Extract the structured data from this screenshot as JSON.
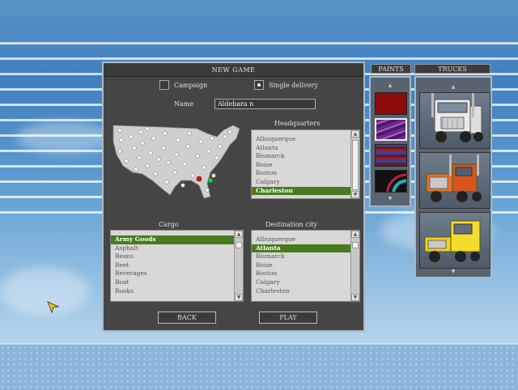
{
  "dialog": {
    "title": "NEW GAME",
    "mode_campaign": "Campaign",
    "mode_single": "Single delivery",
    "name_label": "Name",
    "name_value": "Aldebara n",
    "hq_label": "Headquarters",
    "cargo_label": "Cargo",
    "dest_label": "Destination city",
    "back_label": "BACK",
    "play_label": "PLAY"
  },
  "headquarters": [
    "Albuquerque",
    "Atlanta",
    "Bismarck",
    "Boise",
    "Boston",
    "Calgary",
    "Charleston"
  ],
  "cargo": [
    "Army Goods",
    "Asphalt",
    "Beans",
    "Beet",
    "Beverages",
    "Boat",
    "Books"
  ],
  "destinations": [
    "Albuquerque",
    "Atlanta",
    "Bismarck",
    "Boise",
    "Boston",
    "Calgary",
    "Charleston"
  ],
  "paints_label": "PAINTS",
  "trucks_label": "TRUCKS",
  "paint_swatches": [
    "dark red",
    "purple stripes",
    "red-blue stripes",
    "teal swoosh"
  ],
  "trucks": [
    "white cabover truck",
    "orange long-nose truck",
    "yellow conventional truck"
  ],
  "colors": {
    "selected": "#4a7a1e",
    "panel": "#454545",
    "map_land": "#d0d0d0"
  }
}
